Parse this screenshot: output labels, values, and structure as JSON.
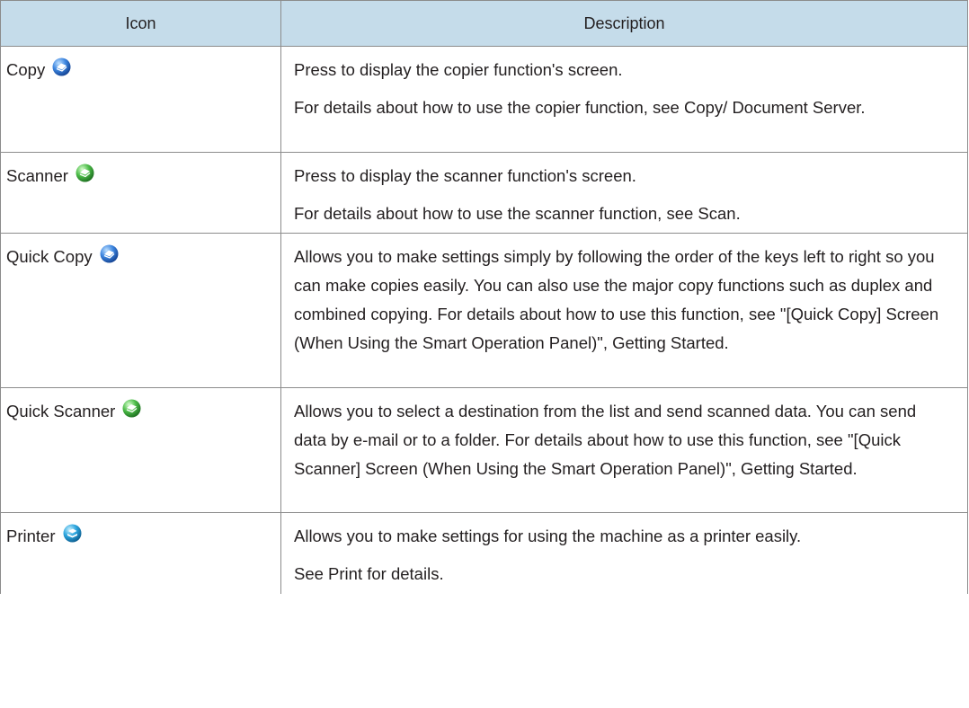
{
  "header": {
    "icon_col": "Icon",
    "desc_col": "Description"
  },
  "rows": [
    {
      "label": "Copy",
      "icon": "copy-icon",
      "icon_color": "#2c6fd1",
      "paragraphs": [
        "Press to display the copier function's screen.",
        "For details about how to use the copier function, see Copy/ Document Server."
      ]
    },
    {
      "label": "Scanner",
      "icon": "scanner-icon",
      "icon_color": "#3ba53b",
      "paragraphs": [
        "Press to display the scanner function's screen.",
        "For details about how to use the scanner function, see Scan."
      ]
    },
    {
      "label": "Quick Copy",
      "icon": "quick-copy-icon",
      "icon_color": "#2c6fd1",
      "paragraphs": [
        "Allows you to make settings simply by following the order of the keys left to right so you can make copies easily. You can also use the major copy functions such as duplex and combined copying. For details about how to use this function, see \"[Quick Copy] Screen (When Using the Smart Operation Panel)\", Getting Started."
      ]
    },
    {
      "label": "Quick Scanner",
      "icon": "quick-scanner-icon",
      "icon_color": "#3ba53b",
      "paragraphs": [
        "Allows you to select a destination from the list and send scanned data. You can send data by e-mail or to a folder. For details about how to use this function, see \"[Quick Scanner] Screen (When Using the Smart Operation Panel)\", Getting Started."
      ]
    },
    {
      "label": "Printer",
      "icon": "printer-icon",
      "icon_color": "#1f9ad6",
      "paragraphs": [
        "Allows you to make settings for using the machine as a printer easily.",
        "See Print for details."
      ]
    }
  ],
  "colors": {
    "header_bg": "#c5dcea",
    "border": "#8c8c8c",
    "text": "#231f20"
  }
}
